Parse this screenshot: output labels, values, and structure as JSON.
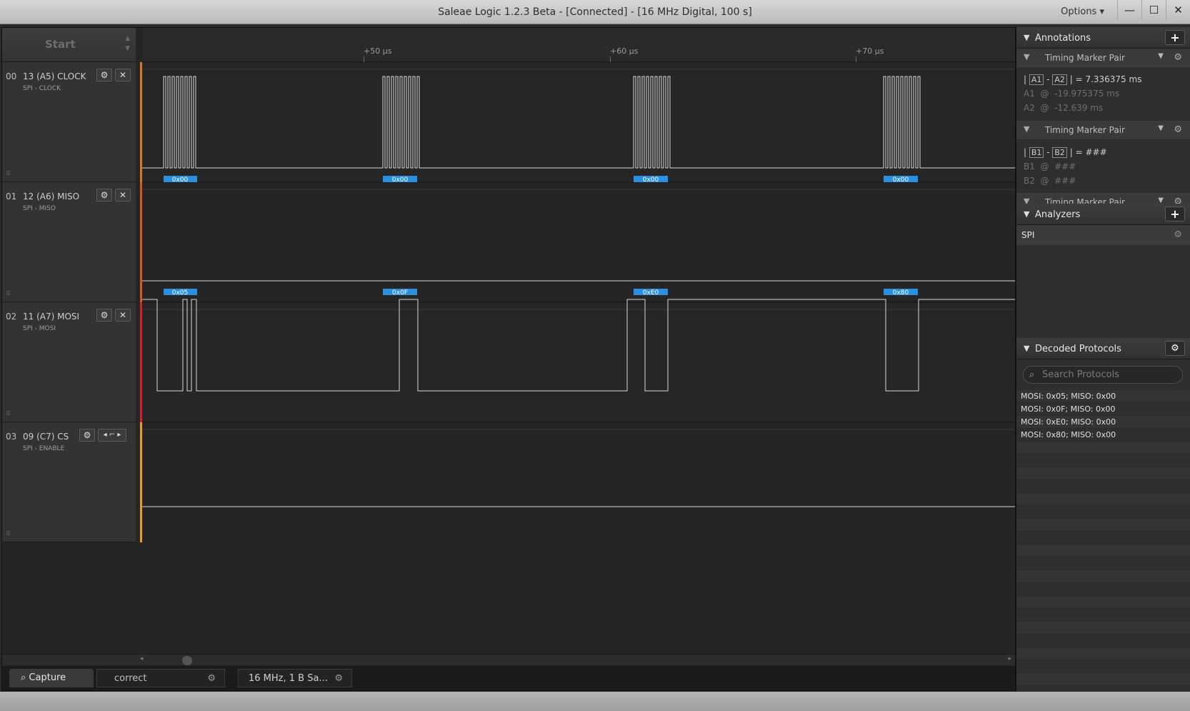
{
  "window": {
    "title": "Saleae Logic 1.2.3 Beta - [Connected] - [16 MHz Digital, 100 s]",
    "options_label": "Options ▾",
    "minimize": "—",
    "maximize": "☐",
    "close": "✕"
  },
  "start": {
    "label": "Start"
  },
  "ruler": {
    "ticks": [
      "+50 µs",
      "+60 µs",
      "+70 µs"
    ]
  },
  "channels": [
    {
      "num": "00",
      "name": "13 (A5) CLOCK",
      "sub": "SPI - CLOCK"
    },
    {
      "num": "01",
      "name": "12 (A6) MISO",
      "sub": "SPI - MISO"
    },
    {
      "num": "02",
      "name": "11 (A7) MOSI",
      "sub": "SPI - MOSI"
    },
    {
      "num": "03",
      "name": "09 (C7) CS",
      "sub": "SPI - ENABLE"
    }
  ],
  "decode_bubbles": {
    "miso": [
      "0x00",
      "0x00",
      "0x00",
      "0x00"
    ],
    "mosi": [
      "0x05",
      "0x0F",
      "0xE0",
      "0x80"
    ]
  },
  "colors": {
    "bubble": "#2b8fe0",
    "clock_edge": "#d07a2a",
    "miso_edge": "#d05a20",
    "mosi_edge": "#d0202a",
    "cs_edge": "#e0a020"
  },
  "tabs": {
    "capture": "Capture",
    "session": "correct",
    "rate": "16 MHz, 1 B Sa..."
  },
  "annotations": {
    "title": "Annotations",
    "marker1": {
      "label": "Timing Marker Pair",
      "a1": "A1",
      "a2": "A2",
      "diff": "7.336375 ms",
      "a1_at": "-19.975375 ms",
      "a2_at": "-12.639 ms"
    },
    "marker2": {
      "label": "Timing Marker Pair",
      "b1": "B1",
      "b2": "B2",
      "diff": "###",
      "b1_at": "###",
      "b2_at": "###"
    },
    "marker3": {
      "label": "Timing Marker Pair"
    }
  },
  "analyzers": {
    "title": "Analyzers",
    "items": [
      "SPI"
    ]
  },
  "decoded": {
    "title": "Decoded Protocols",
    "search_placeholder": "Search Protocols",
    "rows": [
      "MOSI: 0x05;  MISO: 0x00",
      "MOSI: 0x0F;  MISO: 0x00",
      "MOSI: 0xE0;  MISO: 0x00",
      "MOSI: 0x80;  MISO: 0x00"
    ]
  }
}
